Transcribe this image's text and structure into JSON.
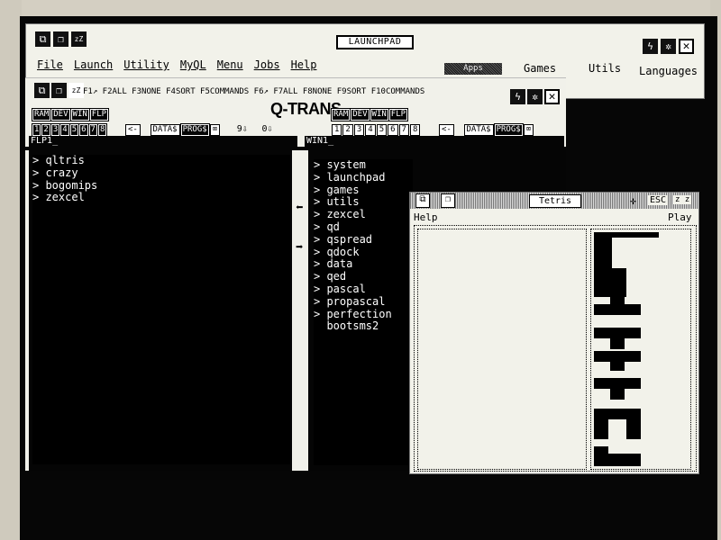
{
  "launchpad": {
    "title": "LAUNCHPAD",
    "menu": [
      "File",
      "Launch",
      "Utility",
      "MyQL",
      "Menu",
      "Jobs",
      "Help"
    ],
    "tabs": {
      "active": "Apps",
      "items": [
        "Games",
        "Utils",
        "Languages"
      ]
    },
    "icons": [
      "window-icon",
      "copy-icon",
      "sleep-icon",
      "lightning-icon",
      "gear-icon",
      "close-icon"
    ]
  },
  "qtrans": {
    "logo": "Q-TRANS",
    "fkeys": "F1↗ F2ALL F3NONE F4SORT F5COMMANDS F6↗ F7ALL F8NONE F9SORT F10COMMANDS",
    "drives": [
      "RAM",
      "DEV",
      "WIN",
      "FLP"
    ],
    "numbers": [
      "1",
      "2",
      "3",
      "4",
      "5",
      "6",
      "7",
      "8"
    ],
    "back": "<-",
    "data_label": "DATA$",
    "prog_label": "PROG$",
    "left_counter": "9⇩",
    "right_counter": "0⇩",
    "left": {
      "path": "FLP1_",
      "files": [
        "qltris",
        "crazy",
        "bogomips",
        "zexcel"
      ]
    },
    "right": {
      "path": "WIN1_",
      "files": [
        "system",
        "launchpad",
        "games",
        "utils",
        "zexcel",
        "qd",
        "qspread",
        "qdock",
        "data",
        "qed",
        "pascal",
        "propascal",
        "perfection"
      ],
      "plain_files": [
        "bootsms2"
      ]
    }
  },
  "tetris": {
    "title": "Tetris",
    "esc": "ESC",
    "sleep": "z z",
    "menu_left": "Help",
    "menu_right": "Play"
  }
}
